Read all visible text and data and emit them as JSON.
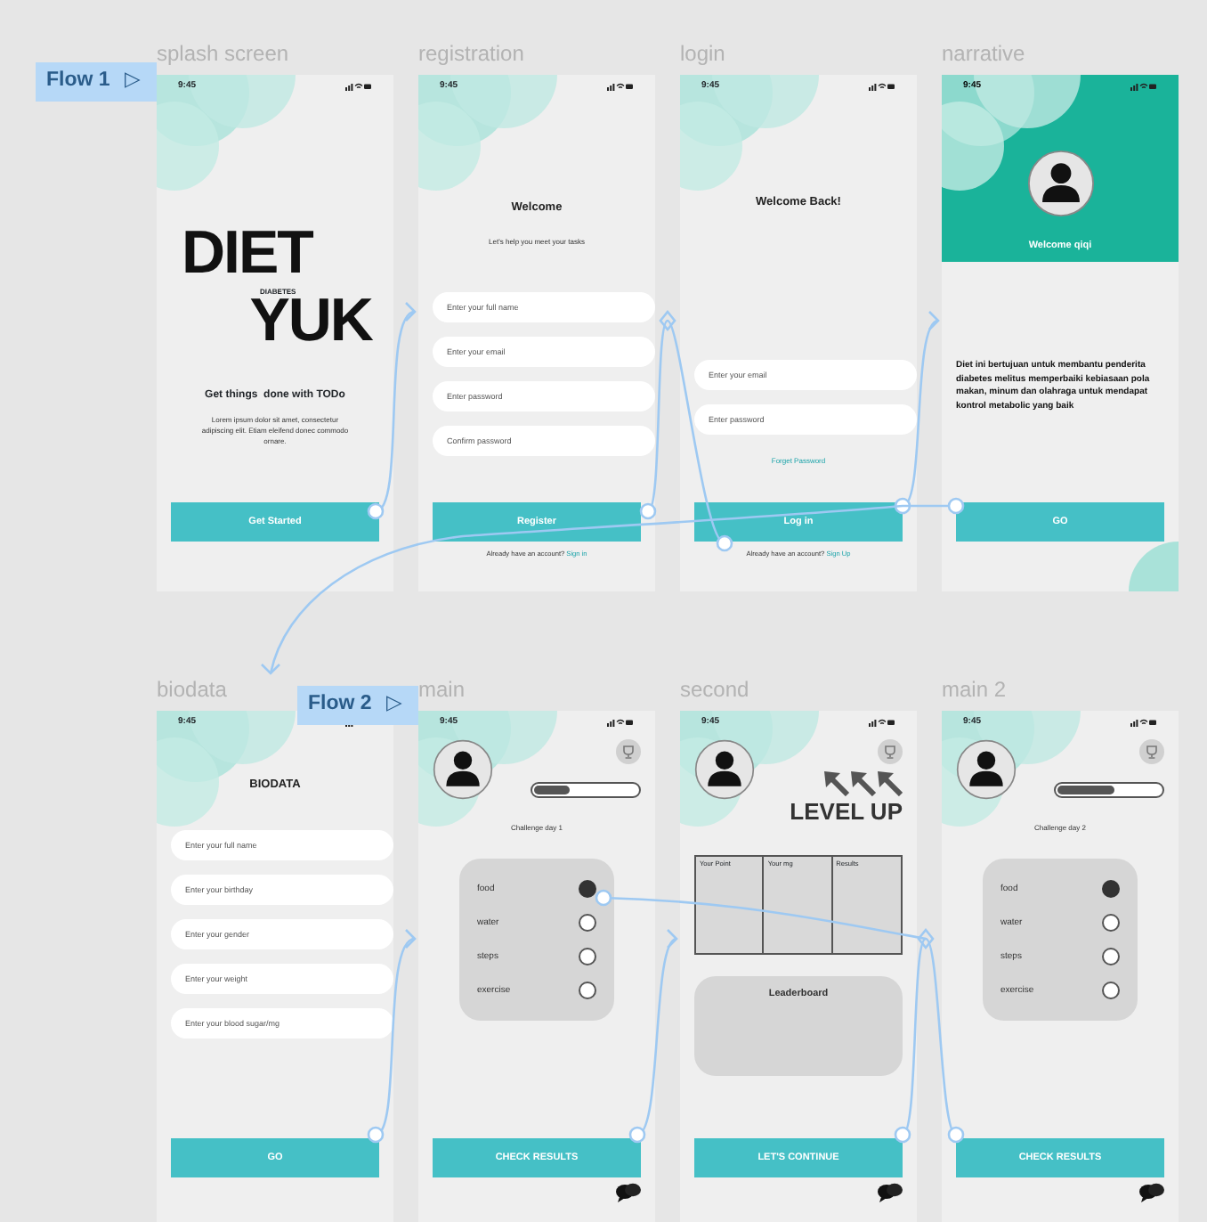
{
  "flows": [
    {
      "label": "Flow 1",
      "icon": "▷"
    },
    {
      "label": "Flow 2",
      "icon": "▷"
    }
  ],
  "frames": [
    {
      "name": "splash screen",
      "kind": "splash",
      "time": "9:45",
      "title": "DIET",
      "subtitle": "DIABETES",
      "title2": "YUK",
      "tagline": "Get things  done with TODo",
      "body": "Lorem ipsum dolor sit amet, consectetur adipiscing elit. Etiam eleifend donec commodo ornare.",
      "button": "Get Started"
    },
    {
      "name": "registration",
      "kind": "form",
      "time": "9:45",
      "heading": "Welcome",
      "subheading": "Let's help you meet your tasks",
      "fields": [
        {
          "placeholder": "Enter your full name"
        },
        {
          "placeholder": "Enter your email"
        },
        {
          "placeholder": "Enter password"
        },
        {
          "placeholder": "Confirm password"
        }
      ],
      "button": "Register",
      "footer": {
        "text": "Already have an account?",
        "link": "Sign in"
      }
    },
    {
      "name": "login",
      "kind": "form",
      "time": "9:45",
      "heading": "Welcome Back!",
      "fields": [
        {
          "placeholder": "Enter your email"
        },
        {
          "placeholder": "Enter password"
        }
      ],
      "link": "Forget Password",
      "button": "Log in",
      "footer": {
        "text": "Already have an account?",
        "link": "Sign Up"
      }
    },
    {
      "name": "narrative",
      "kind": "narrative",
      "time": "9:45",
      "greeting": "Welcome qiqi",
      "body": "Diet ini bertujuan untuk membantu penderita diabetes melitus memperbaiki kebiasaan pola makan, minum dan olahraga untuk mendapat kontrol metabolic yang baik",
      "button": "GO"
    },
    {
      "name": "biodata",
      "kind": "form",
      "time": "9:45",
      "heading": "BIODATA",
      "fields": [
        {
          "placeholder": "Enter your full name"
        },
        {
          "placeholder": "Enter your birthday"
        },
        {
          "placeholder": "Enter your gender"
        },
        {
          "placeholder": "Enter your weight"
        },
        {
          "placeholder": "Enter your blood sugar/mg"
        }
      ],
      "button": "GO"
    },
    {
      "name": "main",
      "kind": "tracker",
      "time": "9:45",
      "level": 0.35,
      "caption": "Challenge day 1",
      "tasks": [
        {
          "label": "food",
          "checked": true
        },
        {
          "label": "water",
          "checked": false
        },
        {
          "label": "steps",
          "checked": false
        },
        {
          "label": "exercise",
          "checked": false
        }
      ],
      "button": "CHECK RESULTS"
    },
    {
      "name": "second",
      "kind": "results",
      "time": "9:45",
      "banner": "LEVEL UP",
      "columns": [
        "Your Point",
        "Your mg",
        "Results"
      ],
      "panel": "Leaderboard",
      "button": "LET'S CONTINUE"
    },
    {
      "name": "main 2",
      "kind": "tracker",
      "time": "9:45",
      "level": 0.55,
      "caption": "Challenge day 2",
      "tasks": [
        {
          "label": "food",
          "checked": true
        },
        {
          "label": "water",
          "checked": false
        },
        {
          "label": "steps",
          "checked": false
        },
        {
          "label": "exercise",
          "checked": false
        }
      ],
      "button": "CHECK RESULTS"
    }
  ]
}
